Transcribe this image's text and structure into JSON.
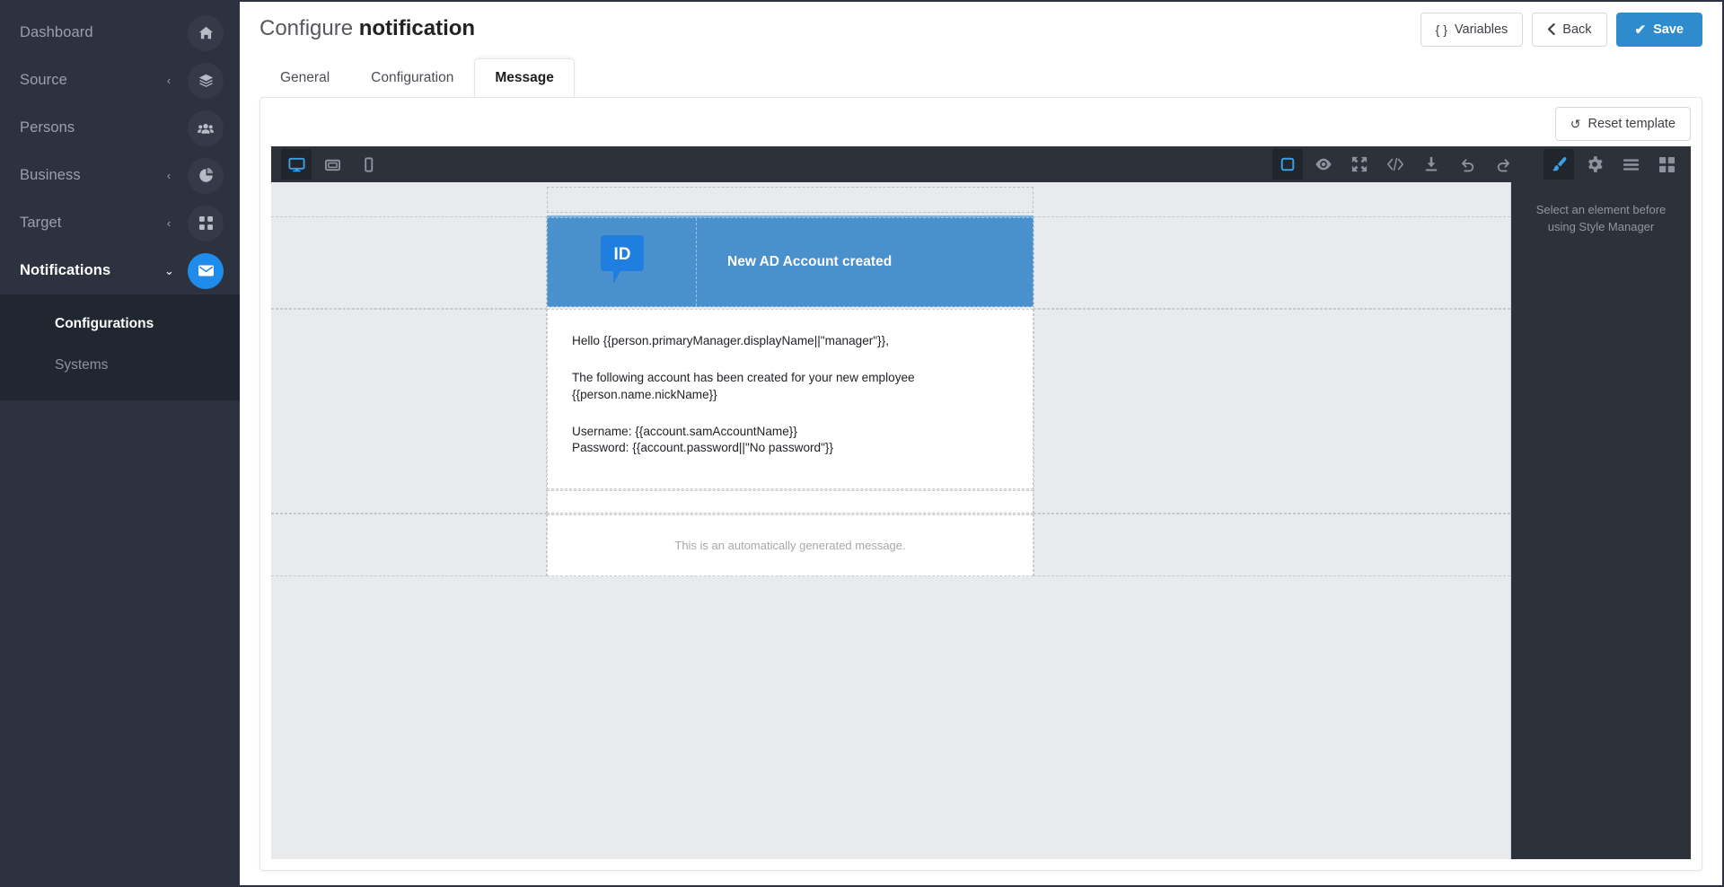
{
  "sidebar": {
    "items": [
      {
        "label": "Dashboard",
        "icon": "home-icon",
        "caret": "",
        "active": false
      },
      {
        "label": "Source",
        "icon": "layers-icon",
        "caret": "‹",
        "active": false
      },
      {
        "label": "Persons",
        "icon": "users-icon",
        "caret": "",
        "active": false
      },
      {
        "label": "Business",
        "icon": "pie-chart-icon",
        "caret": "‹",
        "active": false
      },
      {
        "label": "Target",
        "icon": "grid-icon",
        "caret": "‹",
        "active": false
      },
      {
        "label": "Notifications",
        "icon": "envelope-icon",
        "caret": "⌄",
        "active": true
      }
    ],
    "submenu": [
      {
        "label": "Configurations",
        "active": true
      },
      {
        "label": "Systems",
        "active": false
      }
    ],
    "accent_color": "#1f8ceb",
    "background_color": "#2c323f",
    "submenu_background_color": "#212730"
  },
  "header": {
    "title_prefix": "Configure ",
    "title_strong": "notification",
    "actions": [
      {
        "label": "Variables",
        "icon": "braces-icon",
        "glyph": "{ }",
        "primary": false
      },
      {
        "label": "Back",
        "icon": "chevron-left-icon",
        "glyph": "‹",
        "primary": false
      },
      {
        "label": "Save",
        "icon": "check-icon",
        "glyph": "✔",
        "primary": true
      }
    ],
    "primary_color": "#2e8ccd"
  },
  "tabs": [
    {
      "label": "General",
      "active": false
    },
    {
      "label": "Configuration",
      "active": false
    },
    {
      "label": "Message",
      "active": true
    }
  ],
  "card": {
    "reset_button": {
      "label": "Reset template",
      "icon": "undo-icon",
      "glyph": "↺"
    }
  },
  "editor": {
    "device_buttons": [
      {
        "name": "desktop-view-icon",
        "active": true
      },
      {
        "name": "tablet-view-icon",
        "active": false
      },
      {
        "name": "mobile-view-icon",
        "active": false
      }
    ],
    "tools": [
      {
        "name": "borders-toggle-icon",
        "active": true
      },
      {
        "name": "preview-eye-icon",
        "active": false
      },
      {
        "name": "fullscreen-icon",
        "active": false
      },
      {
        "name": "code-view-icon",
        "active": false
      },
      {
        "name": "import-icon",
        "active": false
      },
      {
        "name": "undo-icon",
        "active": false
      },
      {
        "name": "redo-icon",
        "active": false
      }
    ],
    "panels": [
      {
        "name": "style-manager-brush-icon",
        "active": true
      },
      {
        "name": "settings-gear-icon",
        "active": false
      },
      {
        "name": "layer-manager-icon",
        "active": false
      },
      {
        "name": "blocks-grid-icon",
        "active": false
      }
    ],
    "right_panel": {
      "message": "Select an element before using Style Manager"
    },
    "toolbar_color": "#2c313a",
    "active_icon_color": "#3ba0e8"
  },
  "template": {
    "logo_text": "ID",
    "header_title": "New AD Account created",
    "header_bg": "#4a90cd",
    "body": [
      "Hello {{person.primaryManager.displayName||\"manager\"}},",
      "The following account has been created for your new employee {{person.name.nickName}}",
      "Username: {{account.samAccountName}}",
      "Password: {{account.password||\"No password\"}}"
    ],
    "footer": "This is an automatically generated message."
  }
}
